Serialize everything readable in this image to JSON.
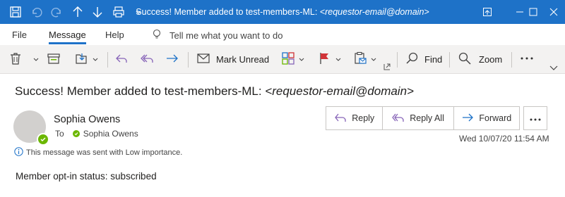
{
  "window": {
    "title_prefix": "Success! Member added to test-members-ML: ",
    "title_email": "<requestor-email@domain>"
  },
  "menu": {
    "tabs": [
      {
        "label": "File"
      },
      {
        "label": "Message",
        "active": true
      },
      {
        "label": "Help"
      }
    ],
    "tell_me": "Tell me what you want to do"
  },
  "ribbon": {
    "mark_unread": "Mark Unread",
    "find": "Find",
    "zoom": "Zoom"
  },
  "message": {
    "subject_prefix": "Success! Member added to test-members-ML: ",
    "subject_email": "<requestor-email@domain>",
    "sender": "Sophia Owens",
    "to_label": "To",
    "recipient": "Sophia Owens",
    "importance_note": "This message was sent with Low importance.",
    "datetime": "Wed 10/07/20 11:54 AM",
    "body": "Member opt-in status: subscribed"
  },
  "actions": {
    "reply": "Reply",
    "reply_all": "Reply All",
    "forward": "Forward"
  },
  "colors": {
    "titlebar": "#1e72c8",
    "accent": "#1e72c8",
    "presence": "#6bb700",
    "ribbon_bg": "#f3f2f1",
    "reply_icon": "#8764b8",
    "forward_icon": "#1e72c8",
    "flag": "#d13438"
  }
}
